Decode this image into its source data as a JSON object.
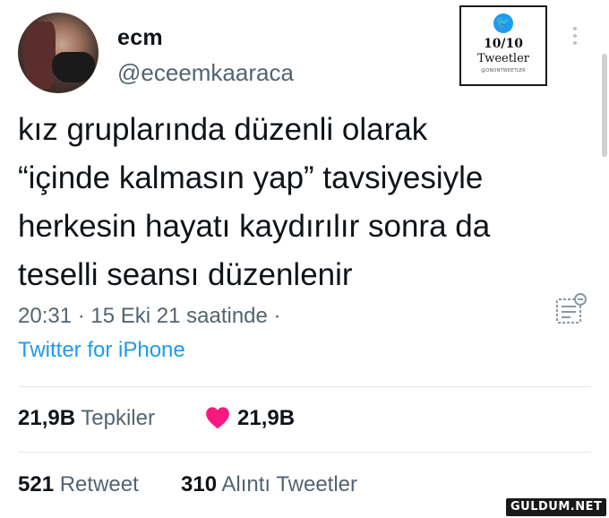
{
  "author": {
    "name": "ecm",
    "handle": "@eceemkaaraca"
  },
  "badge": {
    "score": "10/10",
    "label": "Tweetler",
    "credit": "@ONONTWEETLER"
  },
  "tweet": {
    "lines": [
      "kız gruplarında düzenli olarak",
      "“içinde kalmasın yap” tavsiyesiyle",
      "herkesin hayatı kaydırılır sonra da",
      "teselli seansı düzenlenir"
    ],
    "timestamp": "20:31 · 15 Eki 21 saatinde ·",
    "source": "Twitter for iPhone"
  },
  "stats": {
    "quotes_count": "21,9B",
    "quotes_label": "Tepkiler",
    "likes_count": "21,9B",
    "retweets_count": "521",
    "retweets_label": "Retweet",
    "quote_tweets_count": "310",
    "quote_tweets_label": "Alıntı Tweetler"
  },
  "watermark": "GULDUM.NET",
  "colors": {
    "accent": "#1d9bf0",
    "heart": "#f91880",
    "secondary_text": "#536471"
  }
}
